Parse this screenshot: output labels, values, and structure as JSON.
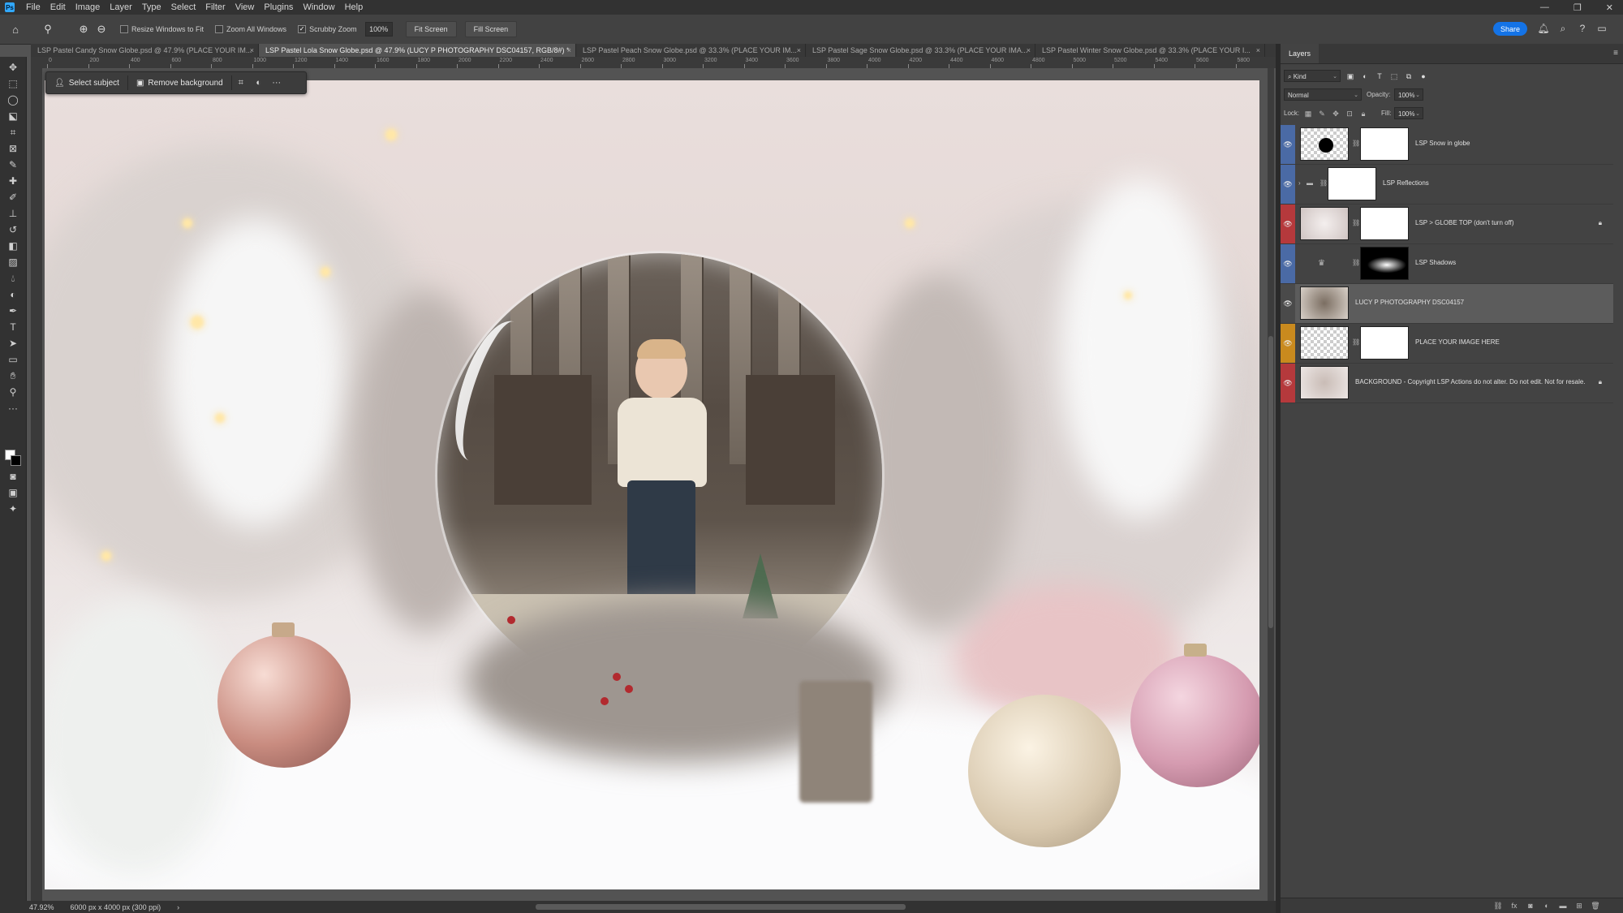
{
  "menubar": {
    "app_badge": "Ps",
    "items": [
      "File",
      "Edit",
      "Image",
      "Layer",
      "Type",
      "Select",
      "Filter",
      "View",
      "Plugins",
      "Window",
      "Help"
    ],
    "window_controls": [
      "—",
      "❐",
      "✕"
    ]
  },
  "options": {
    "resize_windows": "Resize Windows to Fit",
    "zoom_all_windows": "Zoom All Windows",
    "scrubby_zoom": "Scrubby Zoom",
    "zoom_value": "100%",
    "fit_screen": "Fit Screen",
    "fill_screen": "Fill Screen",
    "share": "Share"
  },
  "tabs": [
    {
      "label": "LSP Pastel Candy Snow Globe.psd @ 47.9% (PLACE YOUR IM...",
      "close": "×"
    },
    {
      "label": "LSP Pastel Lola Snow Globe.psd @ 47.9% (LUCY P PHOTOGRAPHY DSC04157, RGB/8#) *",
      "close": "×"
    },
    {
      "label": "LSP Pastel Peach Snow Globe.psd @ 33.3% (PLACE YOUR IM...",
      "close": "×"
    },
    {
      "label": "LSP Pastel Sage Snow Globe.psd @ 33.3% (PLACE YOUR IMA...",
      "close": "×"
    },
    {
      "label": "LSP Pastel Winter Snow Globe.psd @ 33.3% (PLACE YOUR I...",
      "close": "×"
    }
  ],
  "ruler": {
    "labels": [
      "0",
      "200",
      "400",
      "600",
      "800",
      "1000",
      "1200",
      "1400",
      "1600",
      "1800",
      "2000",
      "2200",
      "2400",
      "2600",
      "2800",
      "3000",
      "3200",
      "3400",
      "3600",
      "3800",
      "4000",
      "4200",
      "4400",
      "4600",
      "4800",
      "5000",
      "5200",
      "5400",
      "5600",
      "5800"
    ]
  },
  "taskbar": {
    "select_subject": "Select subject",
    "remove_background": "Remove background",
    "more": "···"
  },
  "status": {
    "zoom": "47.92%",
    "doc_info": "6000 px x 4000 px (300 ppi)",
    "arrow": "›"
  },
  "layers_panel": {
    "title": "Layers",
    "filter_kind": "Kind",
    "blend_mode": "Normal",
    "opacity_label": "Opacity:",
    "opacity_value": "100%",
    "lock_label": "Lock:",
    "fill_label": "Fill:",
    "fill_value": "100%",
    "layers": [
      {
        "name": "LSP Snow in globe",
        "color": "#4a6aa5"
      },
      {
        "name": "LSP Reflections",
        "color": "#4a6aa5"
      },
      {
        "name": "LSP > GLOBE TOP (don't turn off)",
        "color": "#b5393c"
      },
      {
        "name": "LSP Shadows",
        "color": "#4a6aa5"
      },
      {
        "name": "LUCY P PHOTOGRAPHY DSC04157",
        "color": "#4a4a4a"
      },
      {
        "name": "PLACE YOUR IMAGE HERE",
        "color": "#c98a1e"
      },
      {
        "name": "BACKGROUND - Copyright LSP Actions do not alter. Do not edit. Not for resale.",
        "color": "#b5393c"
      }
    ]
  }
}
